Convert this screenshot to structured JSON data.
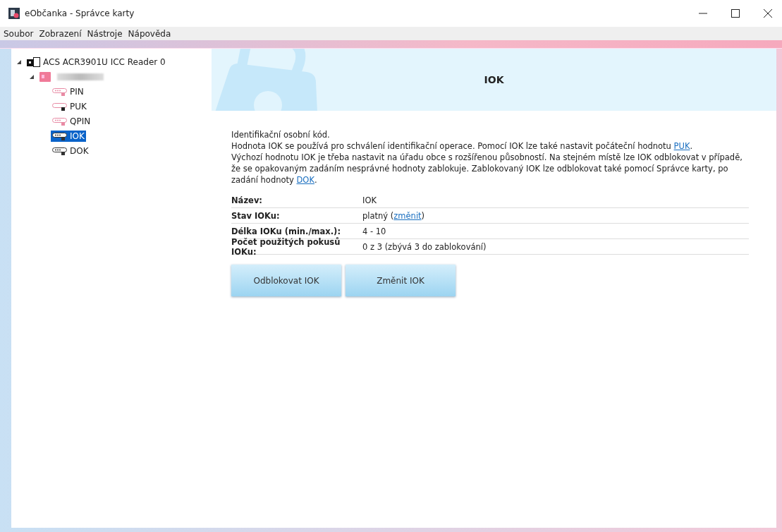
{
  "window": {
    "title": "eObčanka - Správce karty"
  },
  "menu": [
    "Soubor",
    "Zobrazení",
    "Nástroje",
    "Nápověda"
  ],
  "tree": [
    {
      "kind": "reader",
      "label": "ACS ACR3901U ICC Reader 0",
      "expanded": true,
      "selected": false,
      "children": [
        {
          "kind": "card",
          "expanded": true,
          "selected": false,
          "children": [
            {
              "kind": "pin",
              "label": "PIN",
              "selected": false
            },
            {
              "kind": "puk",
              "label": "PUK",
              "selected": false
            },
            {
              "kind": "pin",
              "label": "QPIN",
              "selected": false
            },
            {
              "kind": "iok",
              "label": "IOK",
              "selected": true
            },
            {
              "kind": "iok",
              "label": "DOK",
              "selected": false
            }
          ]
        }
      ]
    }
  ],
  "header": {
    "title": "IOK"
  },
  "description": [
    [
      {
        "kind": "text",
        "text": "Identifikační osobní kód."
      }
    ],
    [
      {
        "kind": "text",
        "text": "Hodnota IOK se používá pro schválení identifikační operace. Pomocí IOK lze také nastavit počáteční hodnotu "
      },
      {
        "kind": "link",
        "text": "PUK"
      },
      {
        "kind": "text",
        "text": "."
      }
    ],
    [
      {
        "kind": "text",
        "text": "Výchozí hodnotu IOK je třeba nastavit na úřadu obce s rozšířenou působností. Na stejném místě lze IOK odblokovat v případě, že se opakovaným zadáním nesprávné hodnoty zablokuje. Zablokovaný IOK lze odblokovat také pomocí Správce karty, po zadání hodnoty "
      },
      {
        "kind": "link",
        "text": "DOK"
      },
      {
        "kind": "text",
        "text": "."
      }
    ]
  ],
  "properties": [
    {
      "label": "Název:",
      "value": [
        {
          "kind": "text",
          "text": "IOK"
        }
      ]
    },
    {
      "label": "Stav IOKu:",
      "value": [
        {
          "kind": "text",
          "text": "platný ("
        },
        {
          "kind": "link",
          "text": "změnit"
        },
        {
          "kind": "text",
          "text": ")"
        }
      ]
    },
    {
      "label": "Délka IOKu (min./max.):",
      "value": [
        {
          "kind": "text",
          "text": "4 - 10"
        }
      ]
    },
    {
      "label": "Počet použitých pokusů IOKu:",
      "value": [
        {
          "kind": "text",
          "text": "0 z 3 (zbývá 3 do zablokování)"
        }
      ]
    }
  ],
  "buttons": [
    "Odblokovat IOK",
    "Změnit IOK"
  ]
}
